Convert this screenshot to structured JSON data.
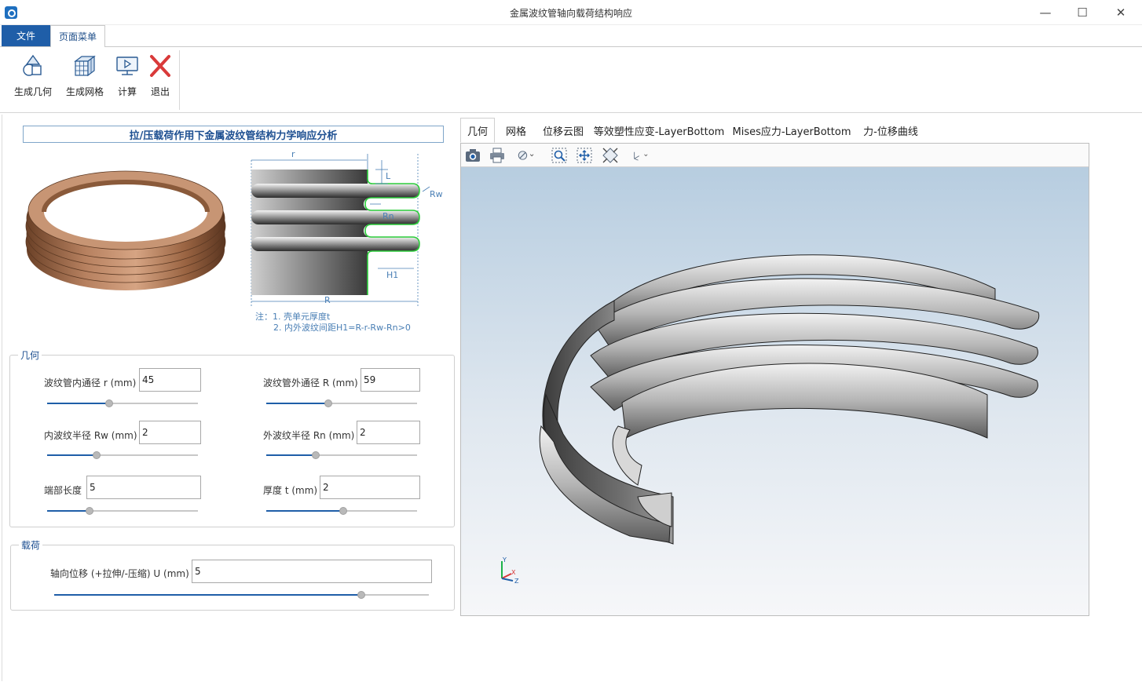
{
  "window": {
    "title": "金属波纹管轴向载荷结构响应",
    "minimize": "—",
    "maximize": "☐",
    "close": "✕"
  },
  "menu": {
    "file": "文件",
    "page_menu": "页面菜单"
  },
  "ribbon": {
    "buttons": [
      {
        "label": "生成几何",
        "icon": "geometry-icon"
      },
      {
        "label": "生成网格",
        "icon": "mesh-icon"
      },
      {
        "label": "计算",
        "icon": "compute-icon"
      },
      {
        "label": "退出",
        "icon": "exit-icon"
      }
    ]
  },
  "left": {
    "heading": "拉/压载荷作用下金属波纹管结构力学响应分析",
    "diagram": {
      "labels": {
        "r": "r",
        "L": "L",
        "Rw": "Rw",
        "Rn": "Rn",
        "H1": "H1",
        "R": "R"
      },
      "note_line1": "注：1. 壳单元厚度t",
      "note_line2": "2. 内外波纹间距H1=R-r-Rw-Rn>0"
    },
    "geometry": {
      "title": "几何",
      "fields": [
        {
          "label": "波纹管内通径 r (mm)",
          "value": "45",
          "slider": 0.41
        },
        {
          "label": "波纹管外通径 R (mm)",
          "value": "59",
          "slider": 0.41
        },
        {
          "label": "内波纹半径 Rw (mm)",
          "value": "2",
          "slider": 0.33
        },
        {
          "label": "外波纹半径 Rn (mm)",
          "value": "2",
          "slider": 0.33
        },
        {
          "label": "端部长度",
          "value": "5",
          "slider": 0.28
        },
        {
          "label": "厚度 t (mm)",
          "value": "2",
          "slider": 0.51
        }
      ]
    },
    "load": {
      "title": "载荷",
      "label": "轴向位移 (+拉伸/-压缩) U (mm)",
      "value": "5",
      "slider": 0.82
    }
  },
  "right": {
    "tabs": [
      "几何",
      "网格",
      "位移云图",
      "等效塑性应变-LayerBottom",
      "Mises应力-LayerBottom",
      "力-位移曲线"
    ],
    "active_tab": 0,
    "toolbar": [
      "camera-icon",
      "print-icon",
      "hide-icon",
      "zoom-window-icon",
      "fit-all-icon",
      "iso-view-icon",
      "axes-icon"
    ],
    "axis": {
      "x": "X",
      "y": "Y",
      "z": "Z"
    }
  },
  "colors": {
    "accent": "#1f5ea8",
    "heading": "#1d4f91",
    "bronze": "#9a6a48"
  }
}
